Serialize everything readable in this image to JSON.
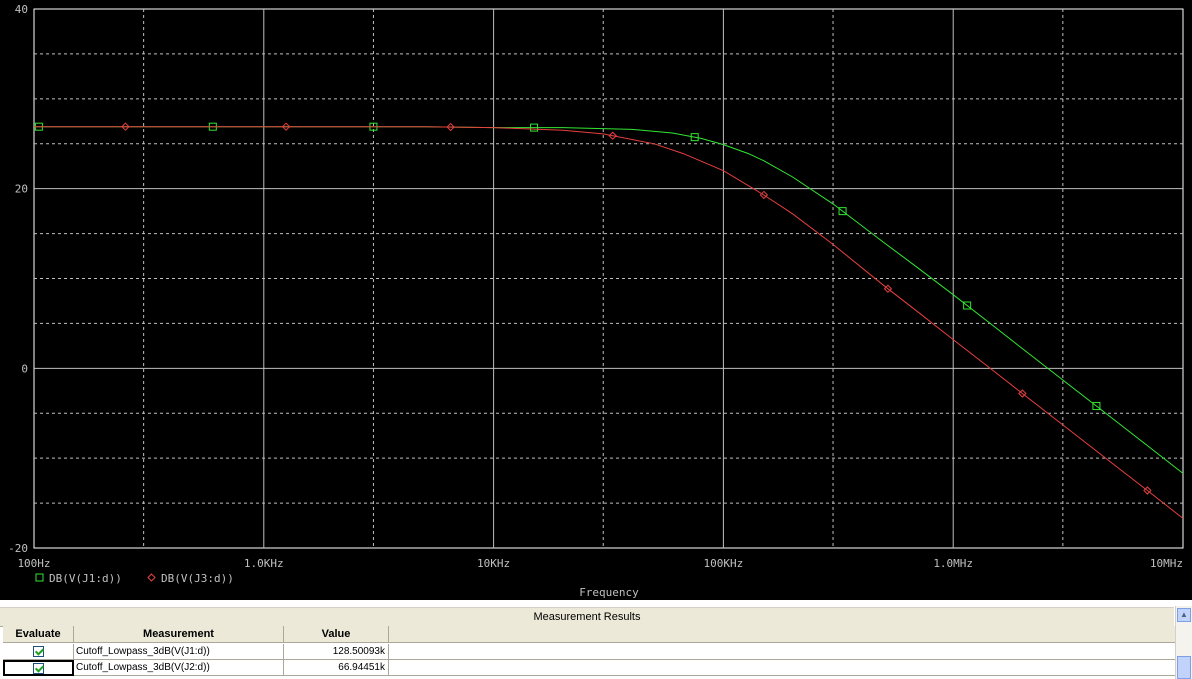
{
  "chart_data": {
    "type": "line",
    "xscale": "log",
    "xlim": [
      100,
      10000000
    ],
    "ylim": [
      -20,
      40
    ],
    "xlabel": "Frequency",
    "x_tick_labels": [
      "100Hz",
      "1.0KHz",
      "10KHz",
      "100KHz",
      "1.0MHz",
      "10MHz"
    ],
    "x_tick_values": [
      100,
      1000,
      10000,
      100000,
      1000000,
      10000000
    ],
    "y_tick_labels": [
      "40",
      "20",
      "0",
      "-20"
    ],
    "y_tick_values": [
      40,
      20,
      0,
      -20
    ],
    "grid": true,
    "background": "#000000",
    "grid_color": "#bfbfbf",
    "legend_position": "bottom-left",
    "series": [
      {
        "name": "DB(V(J1:d))",
        "color": "#33e633",
        "marker": "square",
        "x": [
          100,
          200,
          500,
          1000,
          2000,
          5000,
          10000,
          20000,
          40000,
          60000,
          80000,
          100000,
          128500,
          150000,
          200000,
          300000,
          500000,
          700000,
          1000000,
          1500000,
          2000000,
          3000000,
          5000000,
          7000000,
          10000000
        ],
        "y": [
          26.9,
          26.9,
          26.9,
          26.9,
          26.9,
          26.9,
          26.8,
          26.8,
          26.6,
          26.2,
          25.6,
          24.9,
          23.9,
          23.1,
          21.3,
          18.3,
          14.0,
          11.2,
          8.2,
          4.7,
          2.2,
          -1.3,
          -5.7,
          -8.6,
          -11.7
        ],
        "marker_x": [
          105,
          600,
          3000,
          15000,
          75000,
          330000,
          1150000,
          4200000
        ]
      },
      {
        "name": "DB(V(J3:d))",
        "color": "#e64040",
        "marker": "diamond",
        "x": [
          100,
          200,
          500,
          1000,
          2000,
          5000,
          10000,
          20000,
          30000,
          50000,
          66900,
          100000,
          150000,
          200000,
          300000,
          500000,
          700000,
          1000000,
          1500000,
          2000000,
          3000000,
          5000000,
          7000000,
          10000000
        ],
        "y": [
          26.9,
          26.9,
          26.9,
          26.9,
          26.9,
          26.9,
          26.8,
          26.5,
          26.1,
          25.0,
          23.9,
          22.0,
          19.3,
          17.2,
          13.8,
          9.2,
          6.3,
          3.2,
          -0.3,
          -2.8,
          -6.3,
          -10.7,
          -13.6,
          -16.7
        ],
        "marker_x": [
          250,
          1250,
          6500,
          33000,
          150000,
          520000,
          2000000,
          7000000
        ]
      }
    ]
  },
  "results": {
    "title": "Measurement Results",
    "headers": {
      "evaluate": "Evaluate",
      "measurement": "Measurement",
      "value": "Value"
    },
    "rows": [
      {
        "checked": true,
        "measurement": "Cutoff_Lowpass_3dB(V(J1:d))",
        "value": "128.50093k"
      },
      {
        "checked": true,
        "measurement": "Cutoff_Lowpass_3dB(V(J2:d))",
        "value": "66.94451k"
      }
    ]
  }
}
